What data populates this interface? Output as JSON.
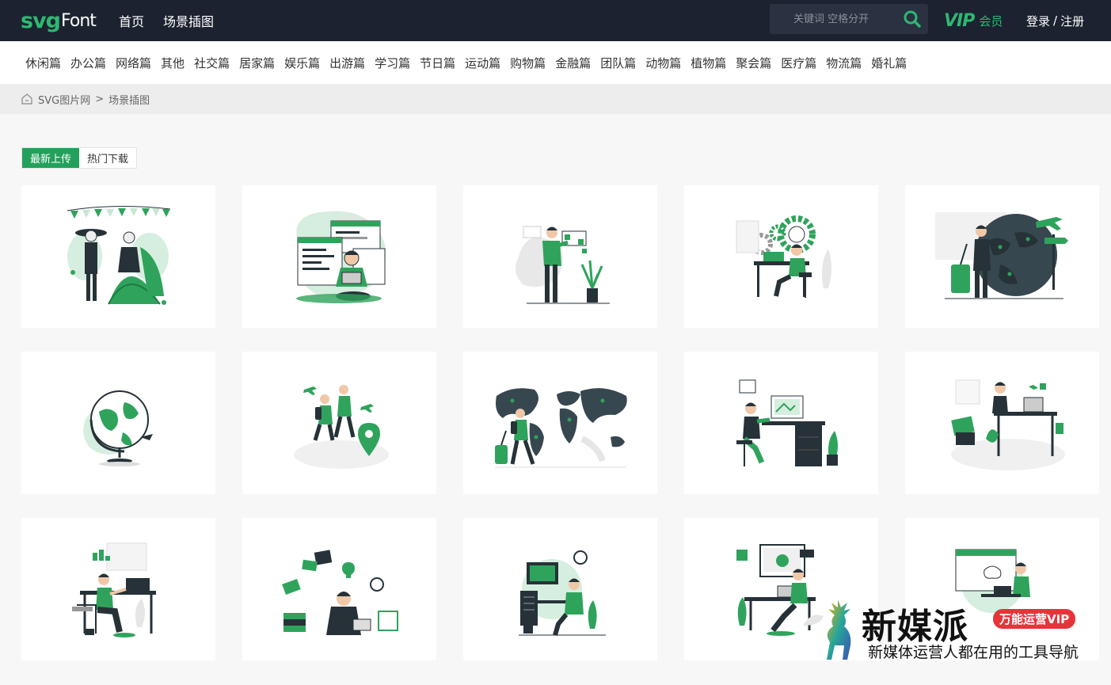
{
  "header": {
    "logo_svg": "svg",
    "logo_font": "Font",
    "nav": [
      "首页",
      "场景插图"
    ],
    "search_placeholder": "关键词 空格分开",
    "vip_mark": "VIP",
    "vip_label": "会员",
    "login": "登录",
    "divider": "/",
    "register": "注册"
  },
  "categories": [
    "休闲篇",
    "办公篇",
    "网络篇",
    "其他",
    "社交篇",
    "居家篇",
    "娱乐篇",
    "出游篇",
    "学习篇",
    "节日篇",
    "运动篇",
    "购物篇",
    "金融篇",
    "团队篇",
    "动物篇",
    "植物篇",
    "聚会篇",
    "医疗篇",
    "物流篇",
    "婚礼篇"
  ],
  "breadcrumb": {
    "site": "SVG图片网",
    "sep": ">",
    "current": "场景插图"
  },
  "tabs": {
    "latest": "最新上传",
    "popular": "热门下载"
  },
  "cards": [
    "festival-dancers-illustration",
    "coder-laptop-illustration",
    "presentation-plant-illustration",
    "office-gears-illustration",
    "travel-globe-illustration",
    "globe-illustration",
    "travelers-location-illustration",
    "world-map-traveler-illustration",
    "desk-worker-illustration",
    "home-office-illustration",
    "laptop-desk-illustration",
    "thinking-man-illustration",
    "designer-desk-illustration",
    "video-call-illustration",
    "remote-work-illustration"
  ],
  "watermark": {
    "brand": "新媒派",
    "badge": "万能运营VIP",
    "slogan": "新媒体运营人都在用的工具导航"
  },
  "colors": {
    "topbar": "#1c2230",
    "accent": "#2eb872",
    "tab_active": "#23a15c",
    "illustration_green": "#2fa35c",
    "illustration_dark": "#263238"
  }
}
